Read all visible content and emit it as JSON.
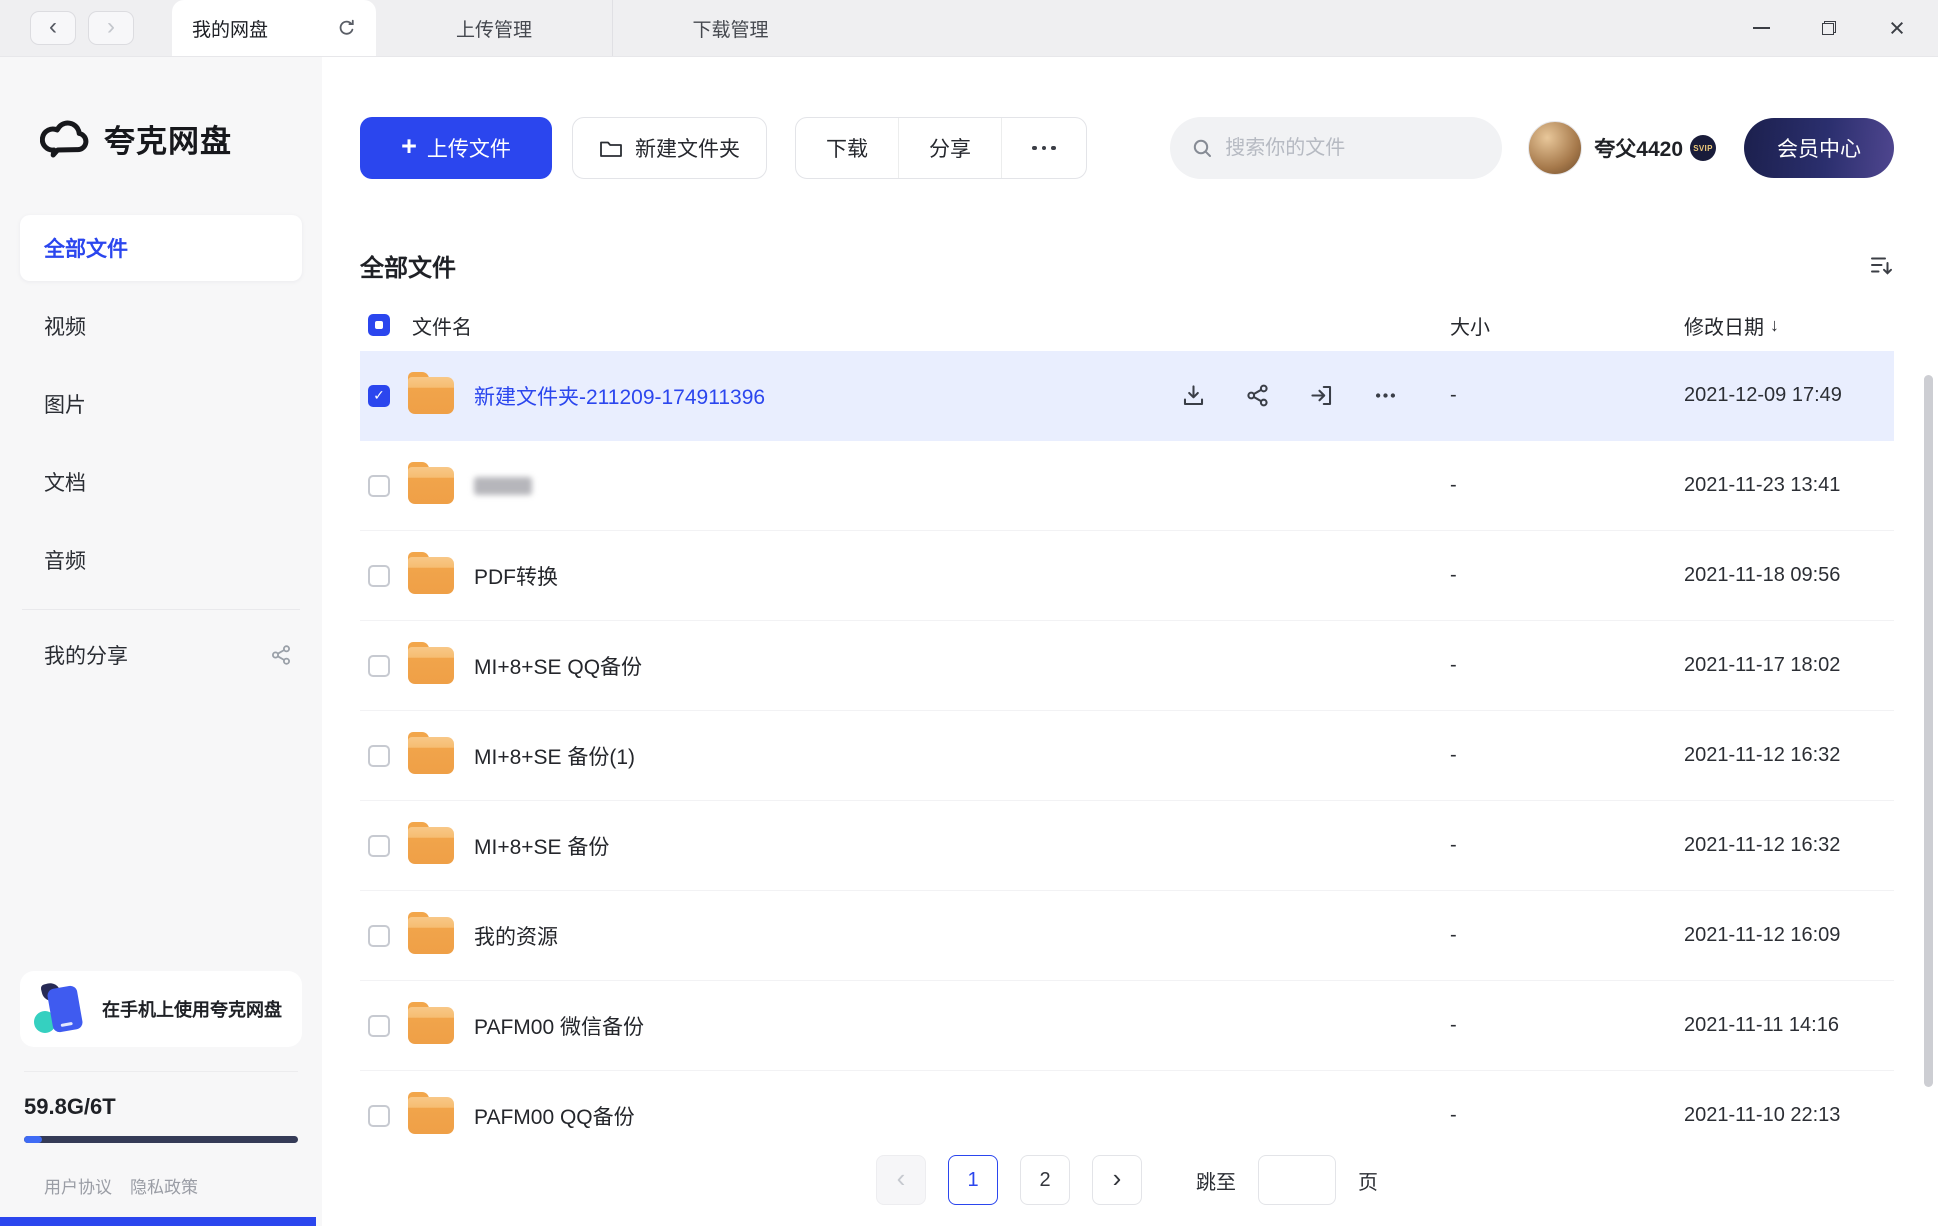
{
  "icons": {
    "back": "‹",
    "forward": "›",
    "close": "×",
    "plus": "+",
    "sort_desc": "↓"
  },
  "titlebar": {
    "tabs": [
      {
        "label": "我的网盘",
        "active": true
      },
      {
        "label": "上传管理",
        "active": false
      },
      {
        "label": "下载管理",
        "active": false
      }
    ]
  },
  "sidebar": {
    "logo_text": "夸克网盘",
    "items": [
      {
        "label": "全部文件",
        "active": true
      },
      {
        "label": "视频",
        "active": false
      },
      {
        "label": "图片",
        "active": false
      },
      {
        "label": "文档",
        "active": false
      },
      {
        "label": "音频",
        "active": false
      }
    ],
    "share_label": "我的分享",
    "promo_text": "在手机上使用夸克网盘",
    "storage_text": "59.8G/6T",
    "footer_links": [
      {
        "label": "用户协议"
      },
      {
        "label": "隐私政策"
      }
    ]
  },
  "toolbar": {
    "upload_label": "上传文件",
    "new_folder_label": "新建文件夹",
    "download_label": "下载",
    "share_label": "分享",
    "search_placeholder": "搜索你的文件",
    "username": "夸父4420",
    "vip_badge": "SVIP",
    "member_center_label": "会员中心"
  },
  "files": {
    "section_title": "全部文件",
    "header": {
      "name": "文件名",
      "size": "大小",
      "date": "修改日期"
    },
    "rows": [
      {
        "name": "新建文件夹-211209-174911396",
        "size": "-",
        "date": "2021-12-09 17:49",
        "selected": true,
        "redacted": false
      },
      {
        "name": "",
        "size": "-",
        "date": "2021-11-23 13:41",
        "selected": false,
        "redacted": true
      },
      {
        "name": "PDF转换",
        "size": "-",
        "date": "2021-11-18 09:56",
        "selected": false,
        "redacted": false
      },
      {
        "name": "MI+8+SE QQ备份",
        "size": "-",
        "date": "2021-11-17 18:02",
        "selected": false,
        "redacted": false
      },
      {
        "name": "MI+8+SE 备份(1)",
        "size": "-",
        "date": "2021-11-12 16:32",
        "selected": false,
        "redacted": false
      },
      {
        "name": "MI+8+SE 备份",
        "size": "-",
        "date": "2021-11-12 16:32",
        "selected": false,
        "redacted": false
      },
      {
        "name": "我的资源",
        "size": "-",
        "date": "2021-11-12 16:09",
        "selected": false,
        "redacted": false
      },
      {
        "name": "PAFM00 微信备份",
        "size": "-",
        "date": "2021-11-11 14:16",
        "selected": false,
        "redacted": false
      },
      {
        "name": "PAFM00 QQ备份",
        "size": "-",
        "date": "2021-11-10 22:13",
        "selected": false,
        "redacted": false
      }
    ]
  },
  "pagination": {
    "pages": [
      "1",
      "2"
    ],
    "current": "1",
    "jump_label": "跳至",
    "unit_label": "页"
  }
}
